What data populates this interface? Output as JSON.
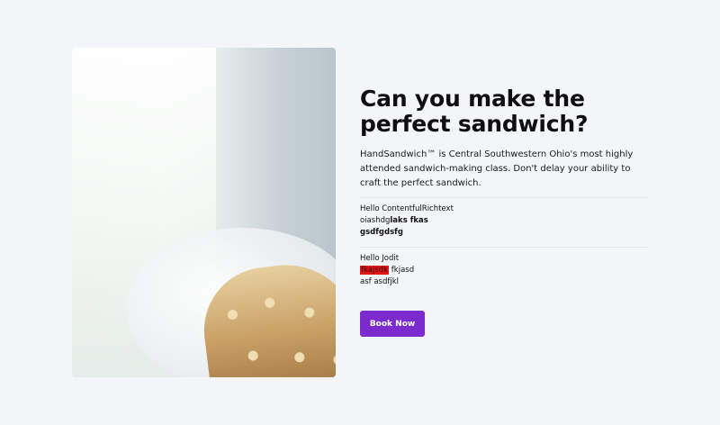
{
  "hero": {
    "image_description_icon": "sandwich-photo"
  },
  "content": {
    "title": "Can you make the perfect sandwich?",
    "description": "HandSandwich™ is Central Southwestern Ohio's most highly attended sandwich-making class. Don't delay your ability to craft the perfect sandwich.",
    "contentful": {
      "heading": "Hello ContentfulRichtext",
      "line2_plain": "oiashdg",
      "line2_bold": "laks fkas",
      "line3_bold": "gsdfgdsfg"
    },
    "jodit": {
      "heading": "Hello Jodit",
      "highlighted": "fkajsdk",
      "after_highlight": " fkjasd",
      "line3": "asf asdfjkl"
    }
  },
  "cta": {
    "label": "Book Now",
    "color": "#7b2bcd"
  }
}
